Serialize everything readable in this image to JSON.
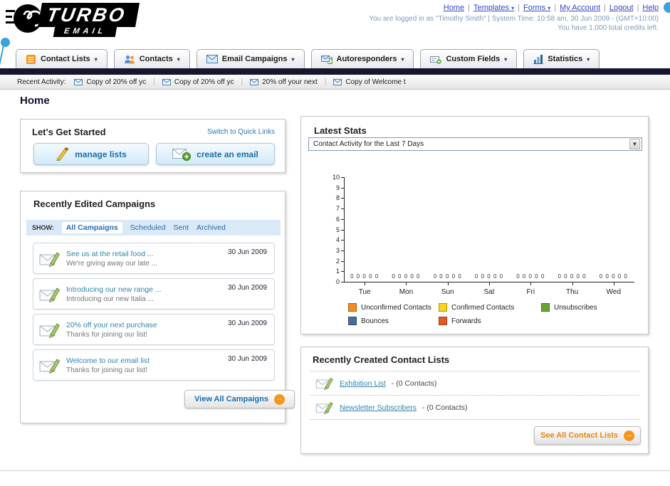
{
  "icons": {
    "dropdown_arrow": "▾",
    "select_arrow": "▼",
    "arrow_right": "→"
  },
  "header": {
    "logo_line1": "TURBO",
    "logo_line2": "EMAIL",
    "links": [
      {
        "label": "Home"
      },
      {
        "label": "Templates",
        "dropdown": true
      },
      {
        "label": "Forms",
        "dropdown": true
      },
      {
        "label": "My Account"
      },
      {
        "label": "Logout"
      },
      {
        "label": "Help"
      }
    ],
    "login_info": "You are logged in as \"Timothy Smith\" | System Time: 10:58 am, 30 Jun 2009 - (GMT+10:00)",
    "credits": "You have 1,000 total credits left."
  },
  "nav": {
    "tabs": [
      {
        "label": "Contact Lists"
      },
      {
        "label": "Contacts"
      },
      {
        "label": "Email Campaigns"
      },
      {
        "label": "Autoresponders"
      },
      {
        "label": "Custom Fields"
      },
      {
        "label": "Statistics"
      }
    ]
  },
  "recent_activity": {
    "label": "Recent Activity:",
    "items": [
      "Copy of 20% off yc",
      "Copy of 20% off yc",
      "20% off your next",
      "Copy of Welcome t"
    ]
  },
  "page_title": "Home",
  "get_started": {
    "title": "Let's Get Started",
    "switch_link": "Switch to Quick Links",
    "manage_lists_button": "manage lists",
    "create_email_button": "create an email"
  },
  "campaigns": {
    "title": "Recently Edited Campaigns",
    "show_label": "SHOW:",
    "filters": [
      "All Campaigns",
      "Scheduled",
      "Sent",
      "Archived"
    ],
    "active_filter": "All Campaigns",
    "items": [
      {
        "title": "See us at the retail food ...",
        "subtitle": "We're giving away our late ...",
        "date": "30 Jun 2009"
      },
      {
        "title": "Introducing our new range ...",
        "subtitle": "Introducing our new Italia ...",
        "date": "30 Jun 2009"
      },
      {
        "title": "20% off your next purchase",
        "subtitle": "Thanks for joining our list!",
        "date": "30 Jun 2009"
      },
      {
        "title": "Welcome to our email list",
        "subtitle": "Thanks for joining our list!",
        "date": "30 Jun 2009"
      }
    ],
    "view_all_button": "View All Campaigns"
  },
  "stats": {
    "title": "Latest Stats",
    "dropdown_value": "Contact Activity for the Last 7 Days"
  },
  "contact_lists": {
    "title": "Recently Created Contact Lists",
    "items": [
      {
        "name": "Exhibition List",
        "detail": "- (0 Contacts)"
      },
      {
        "name": "Newsletter Subscribers",
        "detail": "- (0 Contacts)"
      }
    ],
    "see_all_button": "See All Contact Lists"
  },
  "chart_data": {
    "type": "bar",
    "title": "Contact Activity for the Last 7 Days",
    "categories": [
      "Tue",
      "Mon",
      "Sun",
      "Sat",
      "Fri",
      "Thu",
      "Wed"
    ],
    "series": [
      {
        "name": "Unconfirmed Contacts",
        "color": "#f68a1e",
        "values": [
          0,
          0,
          0,
          0,
          0,
          0,
          0
        ]
      },
      {
        "name": "Confirmed Contacts",
        "color": "#fdd41c",
        "values": [
          0,
          0,
          0,
          0,
          0,
          0,
          0
        ]
      },
      {
        "name": "Unsubscribes",
        "color": "#64a433",
        "values": [
          0,
          0,
          0,
          0,
          0,
          0,
          0
        ]
      },
      {
        "name": "Bounces",
        "color": "#4a6c9b",
        "values": [
          0,
          0,
          0,
          0,
          0,
          0,
          0
        ]
      },
      {
        "name": "Forwards",
        "color": "#e55b22",
        "values": [
          0,
          0,
          0,
          0,
          0,
          0,
          0
        ]
      }
    ],
    "ylim": [
      0,
      10
    ],
    "yticks": [
      0,
      1,
      2,
      3,
      4,
      5,
      6,
      7,
      8,
      9,
      10
    ],
    "xlabel": "",
    "ylabel": "",
    "grid": false,
    "legend_position": "bottom"
  }
}
